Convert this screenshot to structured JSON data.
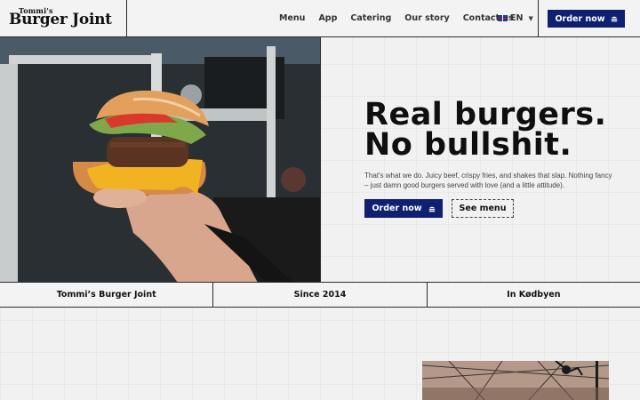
{
  "brand": {
    "logo_small": "Tommi's",
    "logo_big": "Burger Joint"
  },
  "nav": {
    "items": [
      {
        "label": "Menu"
      },
      {
        "label": "App"
      },
      {
        "label": "Catering"
      },
      {
        "label": "Our story"
      },
      {
        "label": "Contact us"
      }
    ],
    "language": "EN",
    "language_flag": "uk-flag-icon",
    "order_label": "Order now"
  },
  "hero": {
    "headline_line1": "Real burgers.",
    "headline_line2": "No bullshit.",
    "subtext": "That's what we do. Juicy beef, crispy fries, and shakes that slap. Nothing fancy – just damn good burgers served with love (and a little attitude).",
    "primary_cta": "Order now",
    "secondary_cta": "See menu"
  },
  "strip": {
    "items": [
      {
        "label": "Tommi’s Burger Joint"
      },
      {
        "label": "Since 2014"
      },
      {
        "label": "In Kødbyen"
      }
    ]
  },
  "colors": {
    "brand_blue": "#0f2070",
    "background": "#f1f1f1",
    "text": "#111111"
  }
}
